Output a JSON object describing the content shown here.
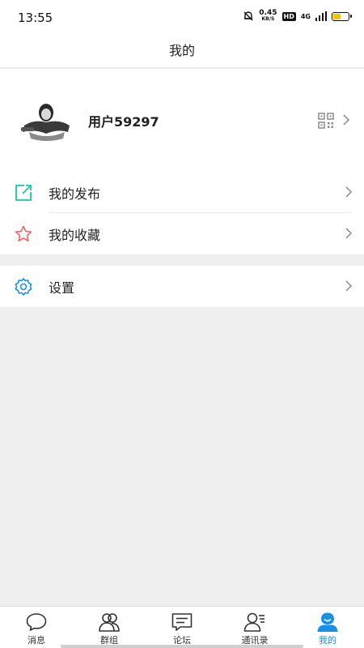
{
  "status": {
    "time": "13:55",
    "speed": "0.45",
    "speed_unit": "KB/S",
    "hd": "HD",
    "network": "4G",
    "battery_level": 0.55
  },
  "header": {
    "title": "我的"
  },
  "profile": {
    "username": "用户59297"
  },
  "menu": {
    "group1": [
      {
        "label": "我的发布",
        "icon": "share-icon",
        "color": "#1dc6a8"
      },
      {
        "label": "我的收藏",
        "icon": "star-icon",
        "color": "#f06464"
      }
    ],
    "group2": [
      {
        "label": "设置",
        "icon": "gear-icon",
        "color": "#1a8fe3"
      }
    ]
  },
  "tabs": [
    {
      "label": "消息",
      "icon": "chat-bubble-icon",
      "active": false
    },
    {
      "label": "群组",
      "icon": "group-icon",
      "active": false
    },
    {
      "label": "论坛",
      "icon": "forum-icon",
      "active": false
    },
    {
      "label": "通讯录",
      "icon": "contacts-icon",
      "active": false
    },
    {
      "label": "我的",
      "icon": "profile-icon",
      "active": true
    }
  ],
  "colors": {
    "accent": "#1a8fe3",
    "page_bg": "#efefef"
  }
}
